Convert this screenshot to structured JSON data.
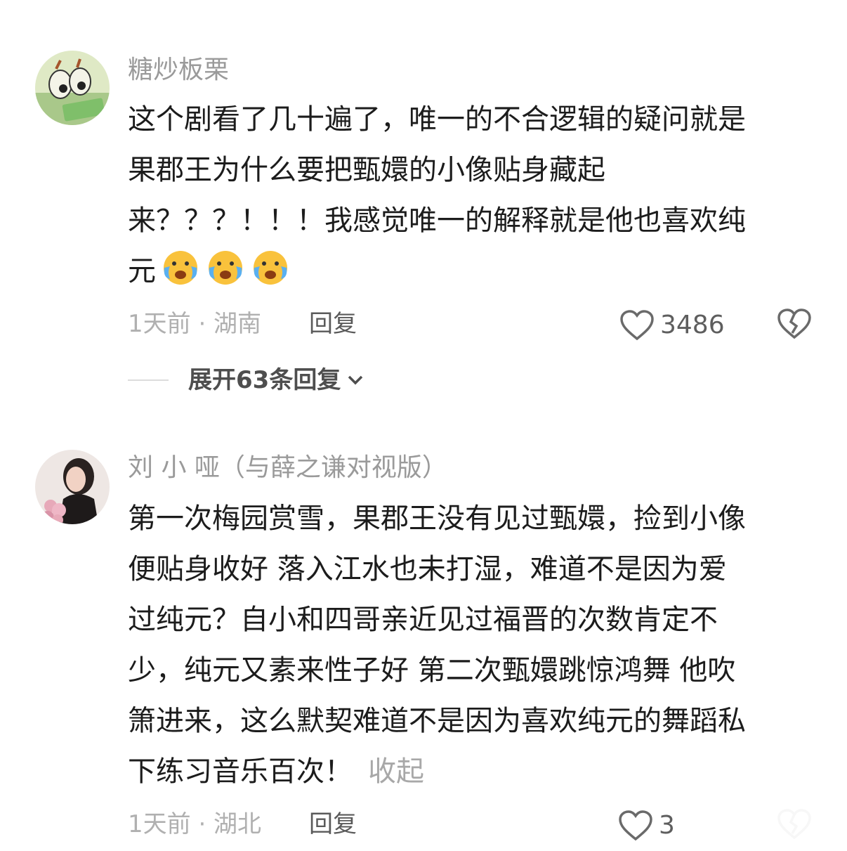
{
  "comments": [
    {
      "username": "糖炒板栗",
      "lines": [
        "这个剧看了几十遍了，唯一的不合逻辑的疑问就是",
        "果郡王为什么要把甄嬛的小像贴身藏起",
        "来？？？！！！我感觉唯一的解释就是他也喜欢纯",
        "元"
      ],
      "emoji_icon": "crying-face-emoji",
      "time_location": "1天前 · 湖南",
      "reply_label": "回复",
      "likes": "3486",
      "expand_label": "展开63条回复"
    },
    {
      "username": "刘 小 哑（与薛之谦对视版）",
      "lines": [
        "第一次梅园赏雪，果郡王没有见过甄嬛，捡到小像",
        "便贴身收好 落入江水也未打湿，难道不是因为爱",
        "过纯元？自小和四哥亲近见过福晋的次数肯定不",
        "少，纯元又素来性子好 第二次甄嬛跳惊鸿舞 他吹",
        "箫进来，这么默契难道不是因为喜欢纯元的舞蹈私",
        "下练习音乐百次！"
      ],
      "collapse_label": "收起",
      "time_location": "1天前 · 湖北",
      "reply_label": "回复",
      "likes": "3"
    }
  ],
  "icons": {
    "like": "heart-outline-icon",
    "dislike": "broken-heart-icon",
    "expand": "chevron-down-icon"
  }
}
